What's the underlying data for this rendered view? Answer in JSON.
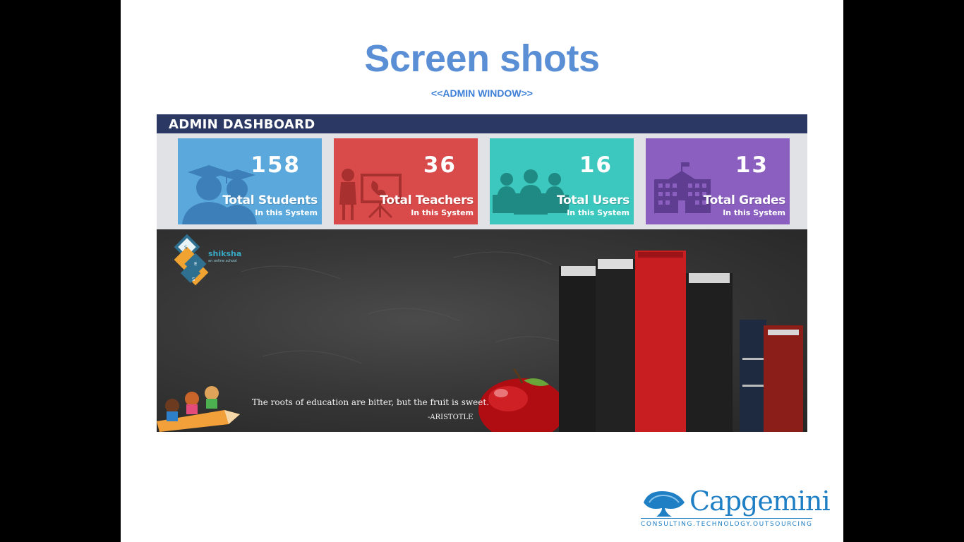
{
  "slide": {
    "title": "Screen shots",
    "subtitle": "<<ADMIN WINDOW>>"
  },
  "dashboard": {
    "header": "ADMIN DASHBOARD",
    "cards": [
      {
        "value": "158",
        "label": "Total Students",
        "sub": "In this System",
        "color": "#5aa8dc",
        "icon": "graduates-icon"
      },
      {
        "value": "36",
        "label": "Total Teachers",
        "sub": "In this System",
        "color": "#d94a4b",
        "icon": "teacher-icon"
      },
      {
        "value": "16",
        "label": "Total Users",
        "sub": "In this System",
        "color": "#3cc8be",
        "icon": "users-icon"
      },
      {
        "value": "13",
        "label": "Total Grades",
        "sub": "In this System",
        "color": "#8b5fc0",
        "icon": "school-icon"
      }
    ],
    "banner": {
      "logo_text": "shiksha",
      "logo_tagline": "an online school",
      "logo_letters": [
        "S",
        "E",
        "S"
      ],
      "quote": "The roots of education are bitter, but the fruit is sweet.",
      "author": "-ARISTOTLE"
    }
  },
  "brand": {
    "name": "Capgemini",
    "tagline": "CONSULTING.TECHNOLOGY.OUTSOURCING",
    "color": "#1f7fc4"
  }
}
